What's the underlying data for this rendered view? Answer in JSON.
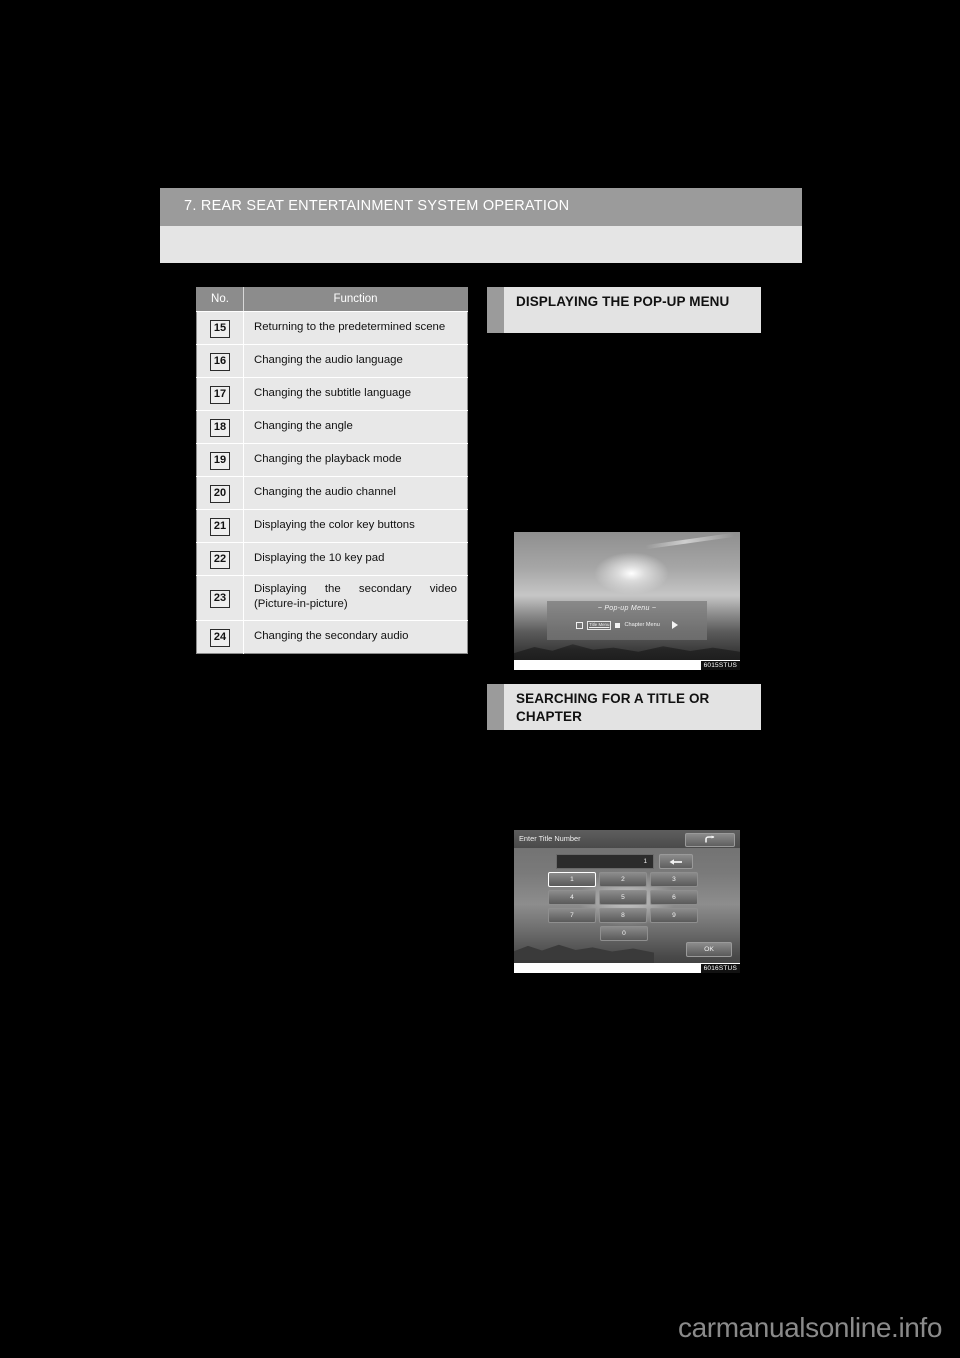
{
  "header": {
    "chapter_title": "7. REAR SEAT ENTERTAINMENT SYSTEM OPERATION"
  },
  "table": {
    "columns": [
      "No.",
      "Function"
    ],
    "rows": [
      {
        "no": "15",
        "function": "Returning to the predetermined scene"
      },
      {
        "no": "16",
        "function": "Changing the audio language"
      },
      {
        "no": "17",
        "function": "Changing the subtitle language"
      },
      {
        "no": "18",
        "function": "Changing the angle"
      },
      {
        "no": "19",
        "function": "Changing the playback mode"
      },
      {
        "no": "20",
        "function": "Changing the audio channel"
      },
      {
        "no": "21",
        "function": "Displaying the color key buttons"
      },
      {
        "no": "22",
        "function": "Displaying the 10 key pad"
      },
      {
        "no": "23",
        "function": "Displaying the secondary video (Picture-in-picture)"
      },
      {
        "no": "24",
        "function": "Changing the secondary audio"
      }
    ]
  },
  "sections": {
    "popup": {
      "heading": "DISPLAYING THE POP-UP MENU",
      "figure": {
        "caption": "6015STUS",
        "panel_title": "~  Pop-up Menu  ~",
        "item_title_menu": "Title Menu",
        "item_chapter_menu": "Chapter Menu"
      }
    },
    "search": {
      "heading": "SEARCHING FOR A TITLE OR CHAPTER",
      "figure": {
        "caption": "6016STUS",
        "screen_title": "Enter Title Number",
        "input_value": "1",
        "keys": [
          "1",
          "2",
          "3",
          "4",
          "5",
          "6",
          "7",
          "8",
          "9"
        ],
        "key_zero": "0",
        "selected_key": "1",
        "ok_label": "OK"
      }
    }
  },
  "footer": {
    "watermark": "carmanualsonline.info"
  }
}
